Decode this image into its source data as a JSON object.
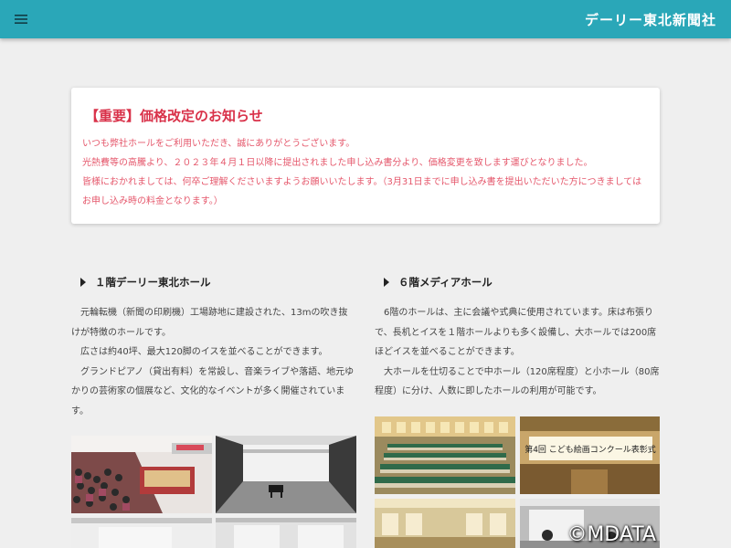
{
  "header": {
    "brand": "デーリー東北新聞社",
    "menu_icon": "hamburger-menu-icon",
    "bar_color": "#2aa7b8"
  },
  "notice": {
    "title": "【重要】価格改定のお知らせ",
    "lines": [
      "いつも弊社ホールをご利用いただき、誠にありがとうございます。",
      "光熱費等の高騰より、２０２３年４月１日以降に提出されました申し込み書分より、価格変更を致します運びとなりました。",
      "皆様におかれましては、何卒ご理解くださいますようお願いいたします。（3月31日までに申し込み書を提出いただいた方につきましてはお申し込み時の料金となります。）"
    ],
    "accent_color": "#d9324a"
  },
  "halls": [
    {
      "heading": "１階デーリー東北ホール",
      "paragraphs": [
        "元輪転機（新聞の印刷機）工場跡地に建設された、13mの吹き抜けが特徴のホールです。",
        "広さは約40坪、最大120脚のイスを並べることができます。",
        "グランドピアノ（貸出有料）を常設し、音楽ライブや落語、地元ゆかりの芸術家の個展など、文化的なイベントが多く開催されています。"
      ]
    },
    {
      "heading": "６階メディアホール",
      "paragraphs": [
        "6階のホールは、主に会議や式典に使用されています。床は布張りで、長机とイスを１階ホールよりも多く設備し、大ホールでは200席ほどイスを並べることができます。",
        "大ホールを仕切ることで中ホール（120席程度）と小ホール（80席程度）に分け、人数に即したホールの利用が可能です。"
      ]
    }
  ],
  "photo_texts": {
    "ceremony_banner": "第4回 こども絵画コンクール表彰式"
  },
  "watermark": "©MDATA"
}
